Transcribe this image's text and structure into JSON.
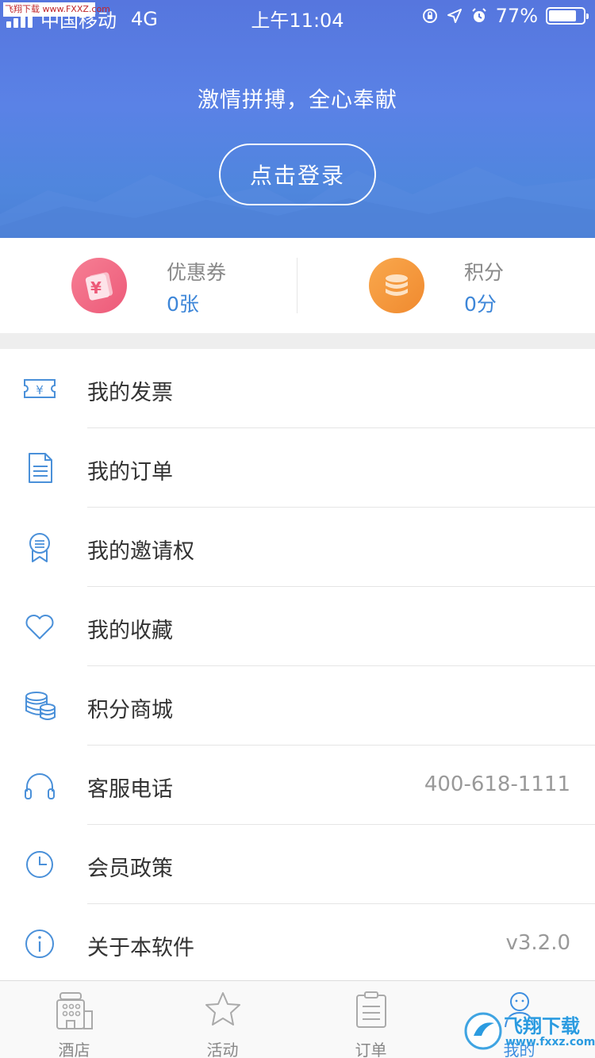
{
  "status_bar": {
    "carrier": "中国移动",
    "network": "4G",
    "time": "上午11:04",
    "battery": "77%"
  },
  "header": {
    "slogan": "激情拼搏，全心奉献",
    "login_label": "点击登录"
  },
  "stats": {
    "coupon": {
      "label": "优惠券",
      "value": "0张",
      "icon": "coupon-icon"
    },
    "points": {
      "label": "积分",
      "value": "0分",
      "icon": "coins-icon"
    }
  },
  "menu": {
    "items": [
      {
        "label": "我的发票",
        "value": "",
        "icon": "invoice-icon"
      },
      {
        "label": "我的订单",
        "value": "",
        "icon": "document-icon"
      },
      {
        "label": "我的邀请权",
        "value": "",
        "icon": "badge-icon"
      },
      {
        "label": "我的收藏",
        "value": "",
        "icon": "heart-icon"
      },
      {
        "label": "积分商城",
        "value": "",
        "icon": "coins-stack-icon"
      },
      {
        "label": "客服电话",
        "value": "400-618-1111",
        "icon": "headphones-icon"
      },
      {
        "label": "会员政策",
        "value": "",
        "icon": "clock-icon"
      },
      {
        "label": "关于本软件",
        "value": "v3.2.0",
        "icon": "info-icon"
      }
    ]
  },
  "tabbar": {
    "tabs": [
      {
        "label": "酒店",
        "icon": "hotel-icon"
      },
      {
        "label": "活动",
        "icon": "star-icon"
      },
      {
        "label": "订单",
        "icon": "clipboard-icon"
      },
      {
        "label": "我的",
        "icon": "user-icon"
      }
    ],
    "active_index": 3
  },
  "watermarks": {
    "top": "飞翔下载 www.FXXZ.com",
    "bottom_title": "飞翔下载",
    "bottom_url": "www.fxxz.com"
  },
  "colors": {
    "header_blue": "#5676de",
    "accent_blue": "#3d86d8",
    "coupon_pink": "#ed5a79",
    "points_orange": "#f08a2f",
    "icon_blue": "#4a90d9"
  }
}
